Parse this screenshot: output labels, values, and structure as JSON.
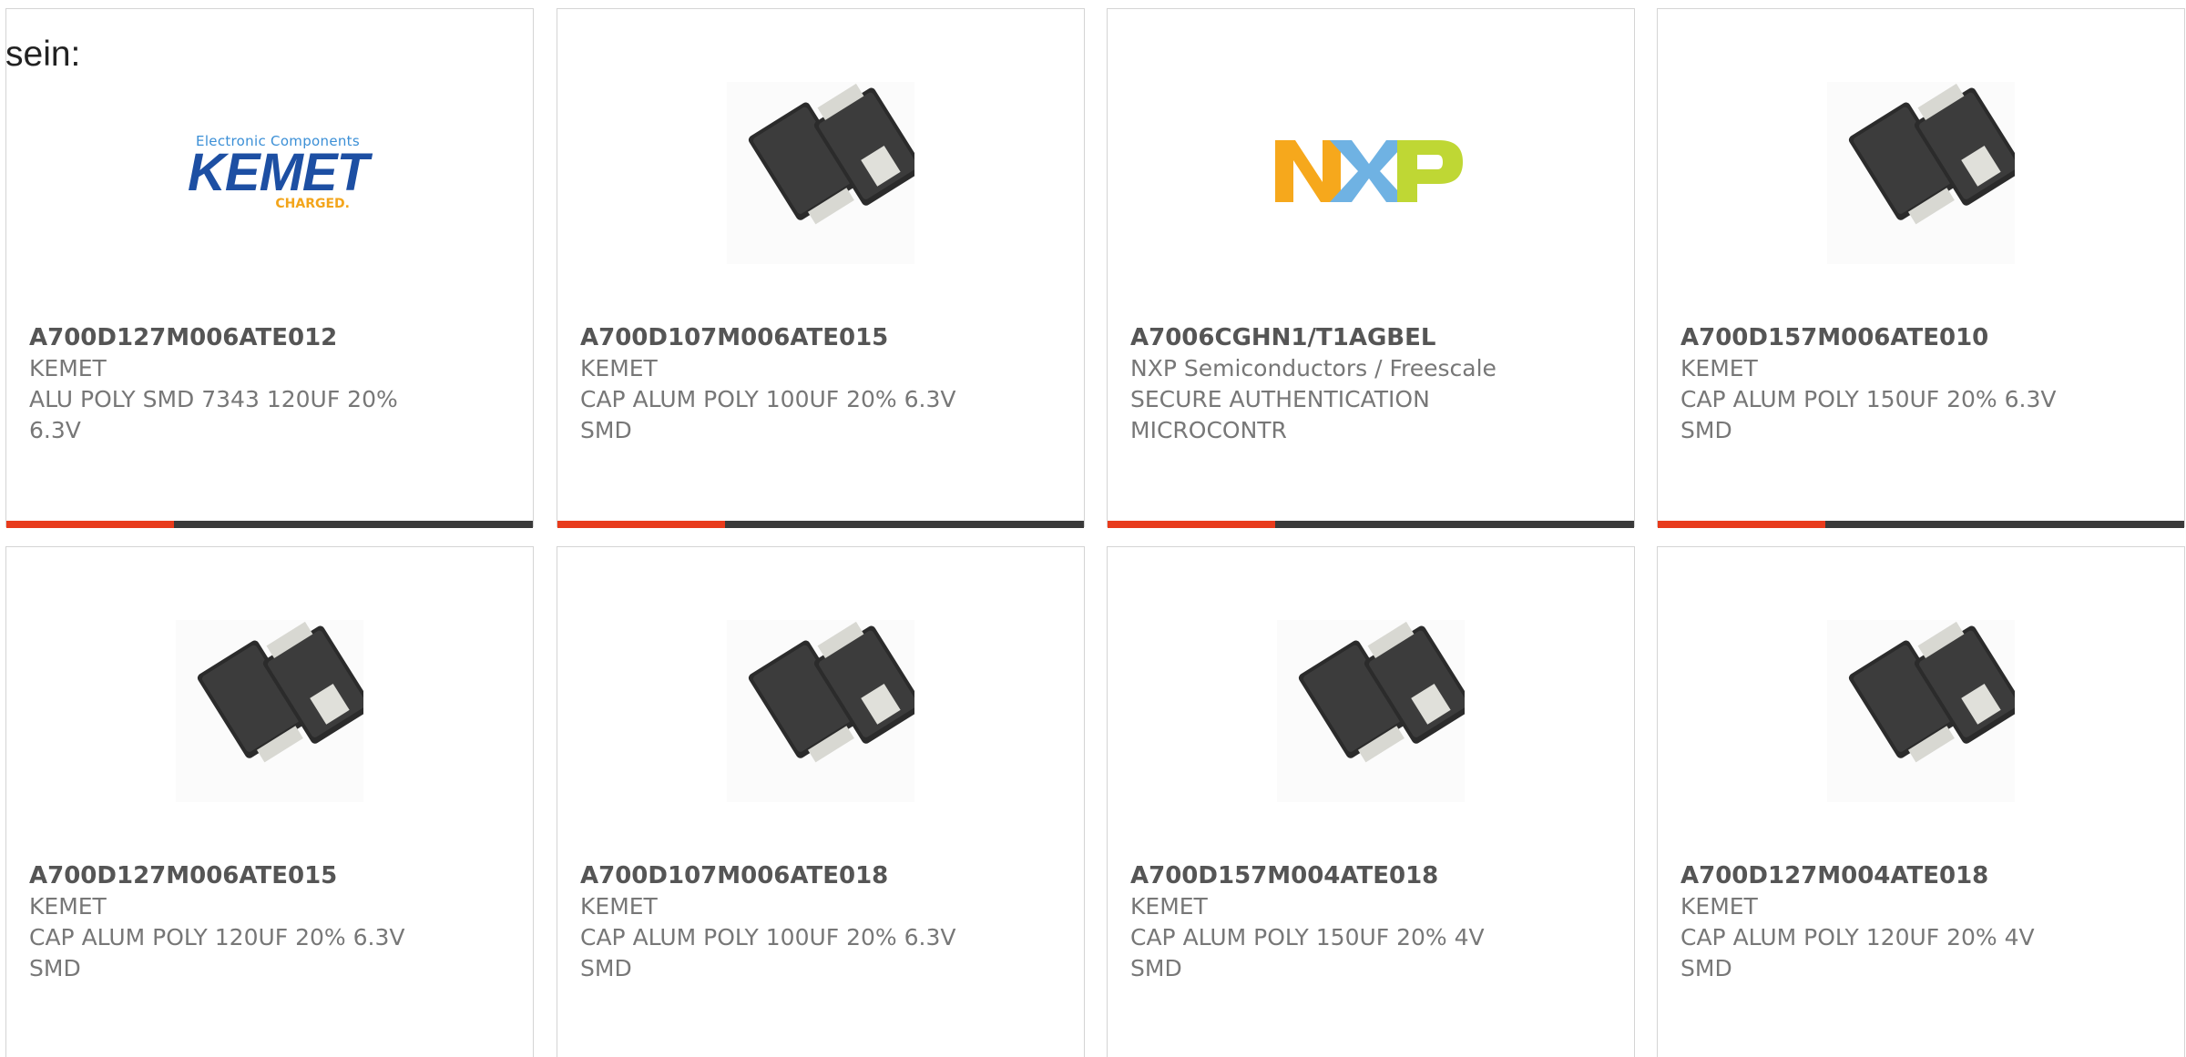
{
  "heading": "sein:",
  "colors": {
    "accent": "#e83b1c",
    "bar": "#3a3a3a",
    "border": "#d4d4d4",
    "part_number": "#555555",
    "text": "#777777"
  },
  "cards": [
    {
      "part_number": "A700D127M006ATE012",
      "manufacturer": "KEMET",
      "desc_line1": "ALU POLY SMD 7343 120UF 20%",
      "desc_line2": "6.3V",
      "image": "kemet-logo",
      "logo": {
        "small": "Electronic Components",
        "big": "KEMET",
        "tag": "CHARGED."
      }
    },
    {
      "part_number": "A700D107M006ATE015",
      "manufacturer": "KEMET",
      "desc_line1": "CAP ALUM POLY 100UF 20% 6.3V",
      "desc_line2": "SMD",
      "image": "capacitor-photo"
    },
    {
      "part_number": "A7006CGHN1/T1AGBEL",
      "manufacturer": "NXP Semiconductors / Freescale",
      "desc_line1": "SECURE AUTHENTICATION",
      "desc_line2": "MICROCONTR",
      "image": "nxp-logo"
    },
    {
      "part_number": "A700D157M006ATE010",
      "manufacturer": "KEMET",
      "desc_line1": "CAP ALUM POLY 150UF 20% 6.3V",
      "desc_line2": "SMD",
      "image": "capacitor-photo"
    },
    {
      "part_number": "A700D127M006ATE015",
      "manufacturer": "KEMET",
      "desc_line1": "CAP ALUM POLY 120UF 20% 6.3V",
      "desc_line2": "SMD",
      "image": "capacitor-photo"
    },
    {
      "part_number": "A700D107M006ATE018",
      "manufacturer": "KEMET",
      "desc_line1": "CAP ALUM POLY 100UF 20% 6.3V",
      "desc_line2": "SMD",
      "image": "capacitor-photo"
    },
    {
      "part_number": "A700D157M004ATE018",
      "manufacturer": "KEMET",
      "desc_line1": "CAP ALUM POLY 150UF 20% 4V",
      "desc_line2": "SMD",
      "image": "capacitor-photo"
    },
    {
      "part_number": "A700D127M004ATE018",
      "manufacturer": "KEMET",
      "desc_line1": "CAP ALUM POLY 120UF 20% 4V",
      "desc_line2": "SMD",
      "image": "capacitor-photo"
    }
  ]
}
